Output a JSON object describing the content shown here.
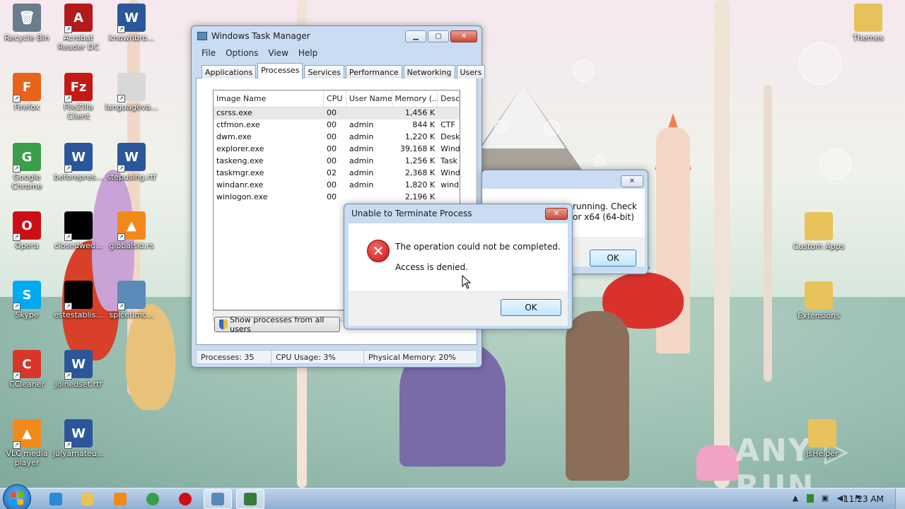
{
  "desktop": {
    "icons": [
      {
        "label": "Recycle Bin",
        "glyph": "🗑",
        "color": "#6a7c8e"
      },
      {
        "label": "Acrobat Reader DC",
        "glyph": "A",
        "color": "#b31b1b"
      },
      {
        "label": "knownbro...",
        "glyph": "W",
        "color": "#2b579a"
      },
      {
        "label": "Firefox",
        "glyph": "F",
        "color": "#e8641b"
      },
      {
        "label": "FileZilla Client",
        "glyph": "Fz",
        "color": "#c41a16"
      },
      {
        "label": "languageva...",
        "glyph": "",
        "color": "#d8d8d8"
      },
      {
        "label": "Google Chrome",
        "glyph": "G",
        "color": "#3a9e4a"
      },
      {
        "label": "beforepres...",
        "glyph": "W",
        "color": "#2b579a"
      },
      {
        "label": "stepusing.rtf",
        "glyph": "W",
        "color": "#2b579a"
      },
      {
        "label": "Opera",
        "glyph": "O",
        "color": "#cc0f16"
      },
      {
        "label": "closedwed...",
        "glyph": "",
        "color": "#000000"
      },
      {
        "label": "globalsid.rs",
        "glyph": "▲",
        "color": "#f28a1b"
      },
      {
        "label": "Skype",
        "glyph": "S",
        "color": "#00a9f0"
      },
      {
        "label": "estestablis...",
        "glyph": "",
        "color": "#000000"
      },
      {
        "label": "spicetimc...",
        "glyph": "",
        "color": "#5a8ab8"
      },
      {
        "label": "CCleaner",
        "glyph": "C",
        "color": "#d8362a"
      },
      {
        "label": "joinedset.rtf",
        "glyph": "W",
        "color": "#2b579a"
      },
      {
        "label": "VLC media player",
        "glyph": "▲",
        "color": "#f28a1b"
      },
      {
        "label": "julyamateu...",
        "glyph": "W",
        "color": "#2b579a"
      },
      {
        "label": "Themes",
        "glyph": "",
        "color": "#e8c25a"
      },
      {
        "label": "Custom Apps",
        "glyph": "",
        "color": "#e8c25a"
      },
      {
        "label": "Extensions",
        "glyph": "",
        "color": "#e8c25a"
      },
      {
        "label": "jsHelper",
        "glyph": "",
        "color": "#e8c25a"
      }
    ],
    "watermark": "ANY ▷ RUN"
  },
  "task_manager": {
    "title": "Windows Task Manager",
    "menu": [
      "File",
      "Options",
      "View",
      "Help"
    ],
    "tabs": [
      "Applications",
      "Processes",
      "Services",
      "Performance",
      "Networking",
      "Users"
    ],
    "active_tab": "Processes",
    "columns": [
      "Image Name",
      "CPU",
      "User Name",
      "Memory (...",
      "Desc"
    ],
    "rows": [
      {
        "name": "csrss.exe",
        "cpu": "00",
        "user": "",
        "mem": "1,456 K",
        "desc": ""
      },
      {
        "name": "ctfmon.exe",
        "cpu": "00",
        "user": "admin",
        "mem": "844 K",
        "desc": "CTF"
      },
      {
        "name": "dwm.exe",
        "cpu": "00",
        "user": "admin",
        "mem": "1,220 K",
        "desc": "Desk"
      },
      {
        "name": "explorer.exe",
        "cpu": "00",
        "user": "admin",
        "mem": "39,168 K",
        "desc": "Wind"
      },
      {
        "name": "taskeng.exe",
        "cpu": "00",
        "user": "admin",
        "mem": "1,256 K",
        "desc": "Task"
      },
      {
        "name": "taskmgr.exe",
        "cpu": "02",
        "user": "admin",
        "mem": "2,368 K",
        "desc": "Wind"
      },
      {
        "name": "windanr.exe",
        "cpu": "00",
        "user": "admin",
        "mem": "1,820 K",
        "desc": "wind"
      },
      {
        "name": "winlogon.exe",
        "cpu": "00",
        "user": "",
        "mem": "2,196 K",
        "desc": ""
      }
    ],
    "show_all_label": "Show processes from all users",
    "status": {
      "processes": "Processes: 35",
      "cpu": "CPU Usage: 3%",
      "memory": "Physical Memory: 20%"
    }
  },
  "back_dialog": {
    "line1": "running. Check",
    "line2": "or x64 (64-bit)",
    "ok_label": "OK"
  },
  "error_dialog": {
    "title": "Unable to Terminate Process",
    "message": "The operation could not be completed.",
    "detail": "Access is denied.",
    "ok_label": "OK"
  },
  "taskbar": {
    "apps": [
      {
        "name": "internet-explorer",
        "color": "#2a8ad8"
      },
      {
        "name": "explorer",
        "color": "#e8c25a"
      },
      {
        "name": "media-player",
        "color": "#f28a1b"
      },
      {
        "name": "chrome",
        "color": "#3a9e4a"
      },
      {
        "name": "opera",
        "color": "#cc0f16"
      },
      {
        "name": "task-manager-a",
        "color": "#5a8ab8"
      },
      {
        "name": "task-manager-b",
        "color": "#3a7a3a"
      }
    ],
    "clock": "11:23 AM"
  }
}
